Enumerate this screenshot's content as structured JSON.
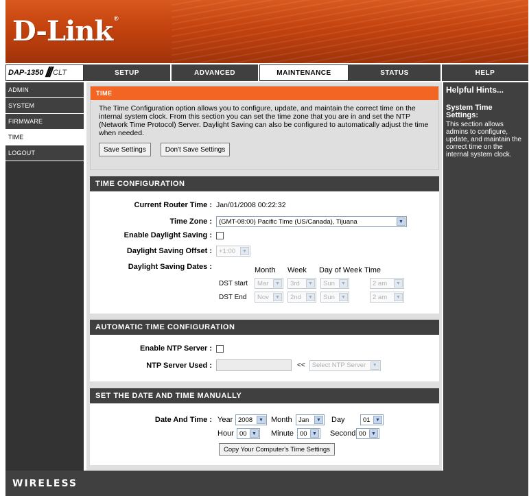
{
  "brand": {
    "logo": "D-Link",
    "registered": "®"
  },
  "model": {
    "name": "DAP-1350",
    "slash": "///",
    "mode": "CLT"
  },
  "tabs": [
    {
      "label": "SETUP",
      "active": false
    },
    {
      "label": "ADVANCED",
      "active": false
    },
    {
      "label": "MAINTENANCE",
      "active": true
    },
    {
      "label": "STATUS",
      "active": false
    },
    {
      "label": "HELP",
      "active": false
    }
  ],
  "sidebar": {
    "items": [
      {
        "label": "ADMIN"
      },
      {
        "label": "SYSTEM"
      },
      {
        "label": "FIRMWARE"
      },
      {
        "label": "TIME"
      },
      {
        "label": "LOGOUT"
      }
    ]
  },
  "intro": {
    "title": "TIME",
    "text": "The Time Configuration option allows you to configure, update, and maintain the correct time on the internal system clock. From this section you can set the time zone that you are in and set the NTP (Network Time Protocol) Server. Daylight Saving can also be configured to automatically adjust the time when needed.",
    "save_label": "Save Settings",
    "dont_save_label": "Don't Save Settings"
  },
  "time_config": {
    "title": "TIME CONFIGURATION",
    "current_time_label": "Current Router Time :",
    "current_time_value": "Jan/01/2008 00:22:32",
    "time_zone_label": "Time Zone :",
    "time_zone_value": "(GMT-08:00) Pacific Time (US/Canada), Tijuana",
    "enable_dst_label": "Enable Daylight Saving :",
    "dst_offset_label": "Daylight Saving Offset :",
    "dst_offset_value": "+1:00",
    "dst_dates_label": "Daylight Saving Dates :",
    "col_month": "Month",
    "col_week": "Week",
    "col_dow": "Day of Week",
    "col_time": "Time",
    "dst_start_label": "DST start",
    "dst_end_label": "DST End",
    "dst_start": {
      "month": "Mar",
      "week": "3rd",
      "dow": "Sun",
      "time": "2 am"
    },
    "dst_end": {
      "month": "Nov",
      "week": "2nd",
      "dow": "Sun",
      "time": "2 am"
    }
  },
  "auto_time": {
    "title": "AUTOMATIC TIME CONFIGURATION",
    "enable_ntp_label": "Enable NTP Server :",
    "ntp_used_label": "NTP Server Used :",
    "arrows": "<<",
    "ntp_select": "Select NTP Server"
  },
  "manual": {
    "title": "SET THE DATE AND TIME MANUALLY",
    "label": "Date And Time :",
    "year_label": "Year",
    "year_value": "2008",
    "month_label": "Month",
    "month_value": "Jan",
    "day_label": "Day",
    "day_value": "01",
    "hour_label": "Hour",
    "hour_value": "00",
    "minute_label": "Minute",
    "minute_value": "00",
    "second_label": "Second",
    "second_value": "00",
    "copy_label": "Copy Your Computer's Time Settings"
  },
  "help": {
    "title": "Helpful Hints...",
    "subtitle": "System Time Settings:",
    "body": "This section allows admins to configure, update, and maintain the correct time on the internal system clock."
  },
  "footer": {
    "text": "WIRELESS"
  },
  "icons": {
    "dropdown": "chevron-down-icon"
  }
}
